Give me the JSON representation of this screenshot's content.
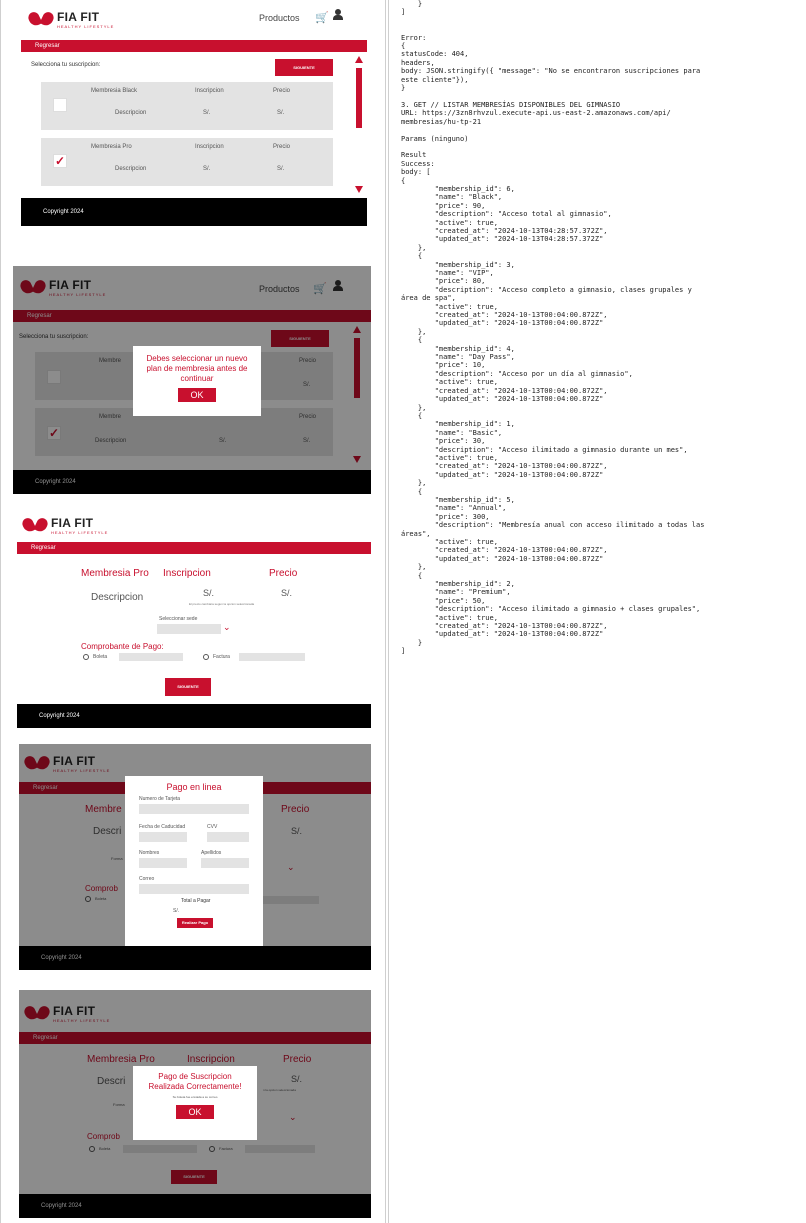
{
  "brand": {
    "name": "FIA FIT",
    "tagline": "HEALTHY LIFESTYLE"
  },
  "nav": {
    "products": "Productos",
    "back": "Regresar"
  },
  "footer": {
    "copyright": "Copyright 2024"
  },
  "screen1": {
    "select_label": "Selecciona tu suscripcion:",
    "next_button": "SIGUIENTE",
    "headers": {
      "inscription": "Inscripcion",
      "price": "Precio"
    },
    "memberships": [
      {
        "name": "Membresia Black",
        "description": "Descripcion",
        "inscription": "S/.",
        "price": "S/.",
        "checked": false
      },
      {
        "name": "Membresia Pro",
        "description": "Descripcion",
        "inscription": "S/.",
        "price": "S/.",
        "checked": true
      }
    ]
  },
  "screen2": {
    "modal_text": "Debes seleccionar un nuevo plan de membresia antes de continuar",
    "ok": "OK",
    "membership_short": "Membre"
  },
  "screen3": {
    "plan_name": "Membresia Pro",
    "inscription_header": "Inscripcion",
    "price_header": "Precio",
    "description": "Descripcion",
    "inscription_value": "S/.",
    "price_value": "S/.",
    "price_note": "El precio cambiara segun la opcion seleccionada",
    "select_site_label": "Seleccionar sede",
    "receipt_title": "Comprobante de Pago:",
    "option_boleta": "Boleta",
    "option_factura": "Factura",
    "next_button": "SIGUIENTE"
  },
  "screen4": {
    "title": "Pago en linea",
    "card_number": "Numero de Tarjeta",
    "expiry": "Fecha de Caducidad",
    "cvv": "CVV",
    "first_names": "Nombres",
    "last_names": "Apellidos",
    "email": "Correo",
    "total_label": "Total a Pagar",
    "total_value": "S/.",
    "pay_button": "Realizar Pago",
    "bg_membership": "Membre",
    "bg_description": "Descri",
    "bg_price": "Precio",
    "bg_price_value": "S/.",
    "bg_receipt": "Comprob",
    "bg_boleta": "Boleta",
    "bg_next": "SIGUIENTE",
    "bg_forma": "Forma"
  },
  "screen5": {
    "title_line1": "Pago de Suscripcion",
    "title_line2": "Realizada Correctamente!",
    "sub": "Su boleta fue enviada a su correo",
    "ok": "OK",
    "bg_plan": "Membresia Pro",
    "bg_inscription": "Inscripcion",
    "bg_price": "Precio",
    "bg_description": "Descri",
    "bg_price_value": "S/.",
    "bg_receipt": "Comprob",
    "bg_boleta": "Boleta",
    "bg_factura": "Factura",
    "bg_next": "SIGUIENTE",
    "bg_forma": "Forma",
    "bg_note": "n la opcion seleccionada"
  },
  "code": {
    "text": "    }\n]\n\n\nError:\n{\nstatusCode: 404,\nheaders,\nbody: JSON.stringify({ \"message\": \"No se encontraron suscripciones para\neste cliente\"}),\n}\n\n3. GET // LISTAR MEMBRESÍAS DISPONIBLES DEL GIMNASIO\nURL: https://3zn8rhvzul.execute-api.us-east-2.amazonaws.com/api/\nmembresias/hu-tp-21\n\nParams (ninguno)\n\nResult\nSuccess:\nbody: [\n{\n        \"membership_id\": 6,\n        \"name\": \"Black\",\n        \"price\": 90,\n        \"description\": \"Acceso total al gimnasio\",\n        \"active\": true,\n        \"created_at\": \"2024-10-13T04:28:57.372Z\",\n        \"updated_at\": \"2024-10-13T04:28:57.372Z\"\n    },\n    {\n        \"membership_id\": 3,\n        \"name\": \"VIP\",\n        \"price\": 80,\n        \"description\": \"Acceso completo a gimnasio, clases grupales y\nárea de spa\",\n        \"active\": true,\n        \"created_at\": \"2024-10-13T00:04:00.872Z\",\n        \"updated_at\": \"2024-10-13T00:04:00.872Z\"\n    },\n    {\n        \"membership_id\": 4,\n        \"name\": \"Day Pass\",\n        \"price\": 10,\n        \"description\": \"Acceso por un día al gimnasio\",\n        \"active\": true,\n        \"created_at\": \"2024-10-13T00:04:00.872Z\",\n        \"updated_at\": \"2024-10-13T00:04:00.872Z\"\n    },\n    {\n        \"membership_id\": 1,\n        \"name\": \"Basic\",\n        \"price\": 30,\n        \"description\": \"Acceso ilimitado a gimnasio durante un mes\",\n        \"active\": true,\n        \"created_at\": \"2024-10-13T00:04:00.872Z\",\n        \"updated_at\": \"2024-10-13T00:04:00.872Z\"\n    },\n    {\n        \"membership_id\": 5,\n        \"name\": \"Annual\",\n        \"price\": 300,\n        \"description\": \"Membresía anual con acceso ilimitado a todas las\náreas\",\n        \"active\": true,\n        \"created_at\": \"2024-10-13T00:04:00.872Z\",\n        \"updated_at\": \"2024-10-13T00:04:00.872Z\"\n    },\n    {\n        \"membership_id\": 2,\n        \"name\": \"Premium\",\n        \"price\": 50,\n        \"description\": \"Acceso ilimitado a gimnasio + clases grupales\",\n        \"active\": true,\n        \"created_at\": \"2024-10-13T00:04:00.872Z\",\n        \"updated_at\": \"2024-10-13T00:04:00.872Z\"\n    }\n]"
  },
  "colors": {
    "accent": "#c8102e",
    "footer": "#000000",
    "panel": "#e3e3e3"
  }
}
